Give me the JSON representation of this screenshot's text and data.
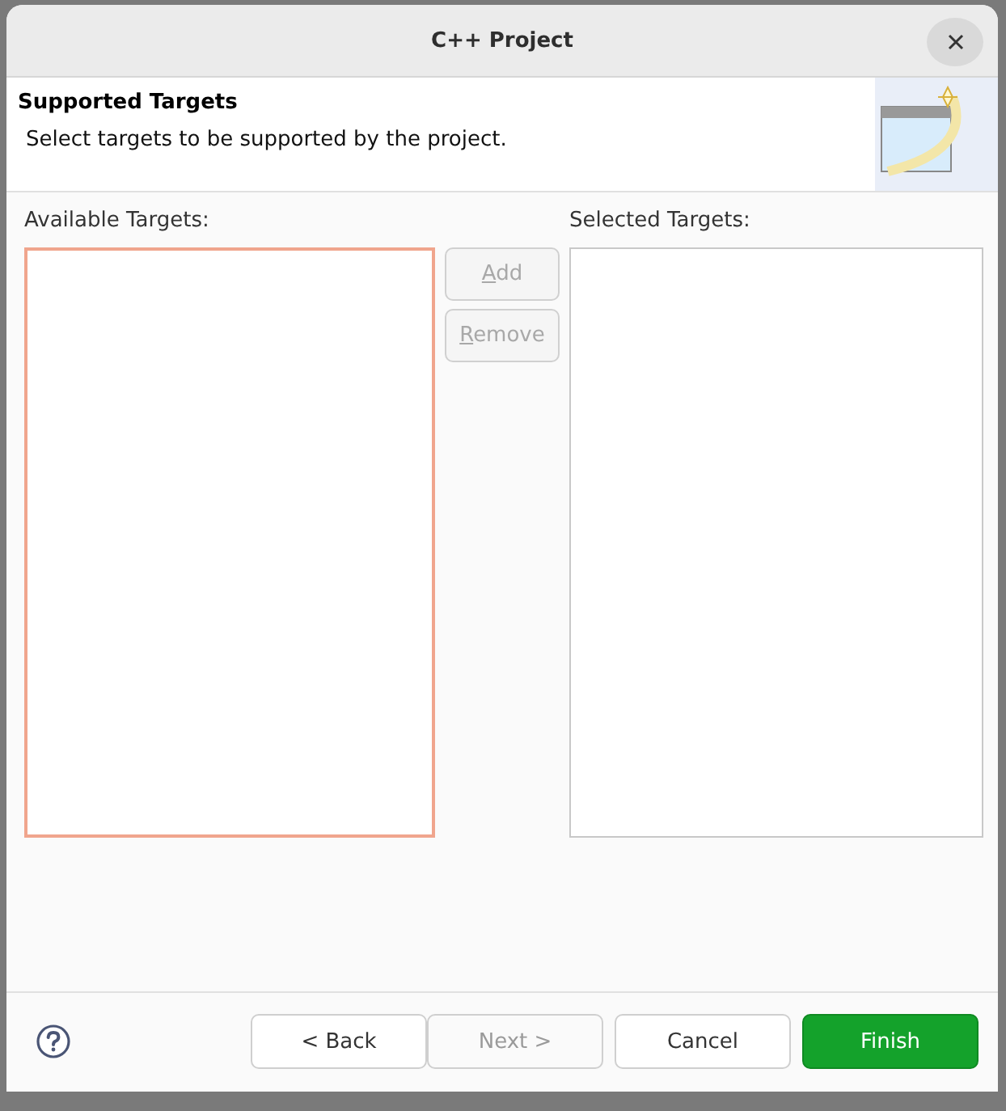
{
  "window": {
    "title": "C++ Project"
  },
  "header": {
    "title": "Supported Targets",
    "description": "Select targets to be supported by the project."
  },
  "available_targets": {
    "label": "Available Targets:",
    "focused": true
  },
  "list_buttons": [
    {
      "label": "Add",
      "disabled": true
    },
    {
      "label": "Remove",
      "disabled": true
    }
  ],
  "selected_targets": {
    "label": "Selected Targets:",
    "focused": false
  },
  "footer_buttons": [
    {
      "label": "< Back",
      "disabled": false,
      "default": false
    },
    {
      "label": "Next >",
      "disabled": true,
      "default": false
    },
    {
      "label": "Cancel",
      "disabled": false,
      "default": false
    },
    {
      "label": "Finish",
      "disabled": false,
      "default": true
    }
  ]
}
